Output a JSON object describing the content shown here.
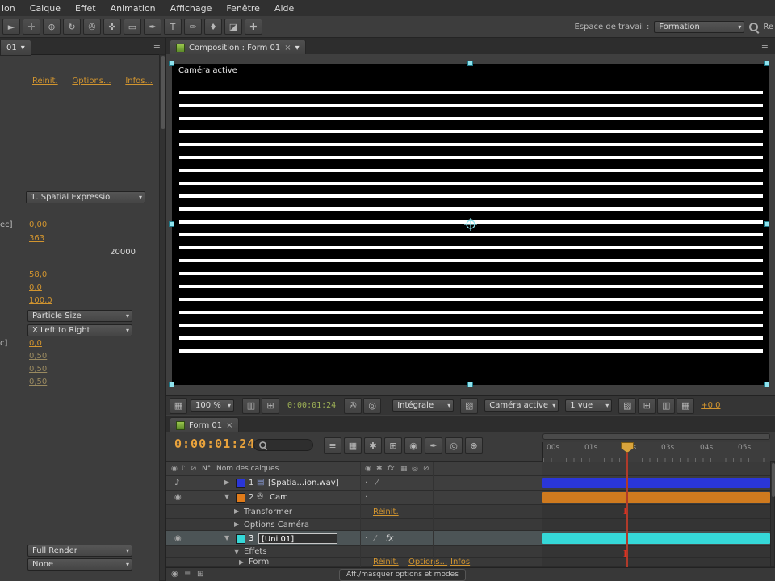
{
  "icons": {
    "chevron_down": "▾",
    "expand": "▶",
    "collapse": "▼",
    "close": "×",
    "panel_menu": "≡",
    "eye": "◉",
    "audio": "♪",
    "solo": "○",
    "lock": "⊘",
    "quality": "⁄",
    "fx": "fx",
    "dot": "·",
    "star": "✱",
    "camera": "✇",
    "file": "▤",
    "grid": "▦",
    "grid_diag": "▧",
    "grid_dense": "▨",
    "grid_light": "▥",
    "plusbox": "⊞",
    "target": "◎",
    "ibeam": "I"
  },
  "menubar": {
    "items": [
      "ion",
      "Calque",
      "Effet",
      "Animation",
      "Affichage",
      "Fenêtre",
      "Aide"
    ]
  },
  "toolbar": {
    "tools": [
      {
        "name": "selection-tool",
        "glyph": "►"
      },
      {
        "name": "hand-tool",
        "glyph": "✛"
      },
      {
        "name": "zoom-tool",
        "glyph": "⊕"
      },
      {
        "name": "rotation-tool",
        "glyph": "↻"
      },
      {
        "name": "camera-tool",
        "glyph": "✇"
      },
      {
        "name": "pan-behind-tool",
        "glyph": "✜"
      },
      {
        "name": "mask-shape-tool",
        "glyph": "▭"
      },
      {
        "name": "pen-tool",
        "glyph": "✒"
      },
      {
        "name": "text-tool",
        "glyph": "T"
      },
      {
        "name": "brush-tool",
        "glyph": "✑"
      },
      {
        "name": "clone-stamp-tool",
        "glyph": "♦"
      },
      {
        "name": "eraser-tool",
        "glyph": "◪"
      },
      {
        "name": "puppet-tool",
        "glyph": "✚"
      }
    ],
    "workspace_label": "Espace de travail :",
    "workspace_value": "Formation",
    "search_text": "Re"
  },
  "effects_panel": {
    "tab": "01",
    "links": {
      "reset": "Réinit.",
      "options": "Options...",
      "infos": "Infos..."
    },
    "expression": "1. Spatial Expressio",
    "cut1": "ec]",
    "v1": "0,00",
    "v2": "363",
    "vmax": "20000",
    "v3": "58,0",
    "v4": "0,0",
    "v5": "100,0",
    "dd1": "Particle Size",
    "dd2": "X Left to Right",
    "cut2": "c]",
    "v6": "0,0",
    "v7": "0,50",
    "v8": "0,50",
    "v9": "0,50",
    "dd3": "Full Render",
    "dd4": "None"
  },
  "comp": {
    "tab": "Composition : Form 01",
    "overlay": "Caméra active",
    "zoom": "100 %",
    "timecode": "0:00:01:24",
    "resolution": "Intégrale",
    "camera": "Caméra active",
    "views": "1 vue",
    "exposure": "+0,0"
  },
  "timeline": {
    "tab": "Form 01",
    "timecode": "0:00:01:24",
    "buttons": [
      {
        "name": "comp-mini-flowchart-button",
        "glyph": "≡"
      },
      {
        "name": "draft-3d-button",
        "glyph": "▦"
      },
      {
        "name": "shy-layers-button",
        "glyph": "✱"
      },
      {
        "name": "frame-blend-button",
        "glyph": "⊞"
      },
      {
        "name": "motion-blur-button",
        "glyph": "◉"
      },
      {
        "name": "brainstorm-button",
        "glyph": "✒"
      },
      {
        "name": "auto-keyframe-button",
        "glyph": "◎"
      },
      {
        "name": "graph-editor-button",
        "glyph": "⊕"
      }
    ],
    "ruler": [
      "00s",
      "01s",
      "02s",
      "03s",
      "04s",
      "05s"
    ],
    "header": {
      "num": "N°",
      "name": "Nom des calques"
    },
    "layer1": {
      "num": "1",
      "name": "[Spatia...ion.wav]"
    },
    "layer2": {
      "num": "2",
      "name": "Cam",
      "child1": "Transformer",
      "child2": "Options Caméra",
      "reset": "Réinit."
    },
    "layer3": {
      "num": "3",
      "name": "[Uni 01]",
      "child1": "Effets",
      "child2": "Form",
      "reset": "Réinit.",
      "options": "Options...",
      "infos": "Infos"
    },
    "status_button": "Aff./masquer options et modes"
  },
  "colors": {
    "accent_orange": "#d2952f",
    "timecode_orange": "#e8a23c",
    "bar_blue": "#2a36d8",
    "bar_orange": "#cf7a1e",
    "bar_cyan": "#35d8d8",
    "handle_cyan": "#8ee3ee"
  }
}
